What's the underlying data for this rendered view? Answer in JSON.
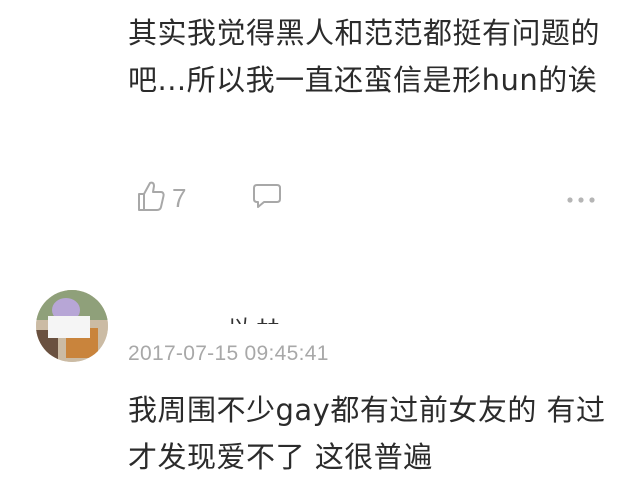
{
  "comments": [
    {
      "text": "其实我觉得黑人和范范都挺有问题的吧...所以我一直还蛮信是形hun的诶",
      "like_count": "7"
    },
    {
      "username_visible": "- 、 以 ‡‡",
      "timestamp": "2017-07-15 09:45:41",
      "text": "我周围不少gay都有过前女友的 有过才发现爱不了 这很普遍"
    }
  ],
  "icons": {
    "like": "thumbs-up-icon",
    "reply": "comment-bubble-icon",
    "more": "more-dots-icon"
  },
  "colors": {
    "text": "#2b2b2b",
    "muted": "#a8a8a8",
    "background": "#ffffff"
  }
}
